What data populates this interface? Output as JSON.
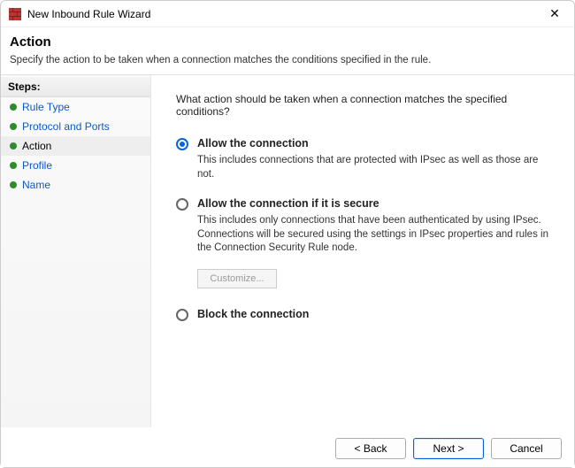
{
  "window": {
    "title": "New Inbound Rule Wizard"
  },
  "header": {
    "title": "Action",
    "subtitle": "Specify the action to be taken when a connection matches the conditions specified in the rule."
  },
  "steps": {
    "label": "Steps:",
    "items": [
      {
        "label": "Rule Type",
        "current": false
      },
      {
        "label": "Protocol and Ports",
        "current": false
      },
      {
        "label": "Action",
        "current": true
      },
      {
        "label": "Profile",
        "current": false
      },
      {
        "label": "Name",
        "current": false
      }
    ]
  },
  "main": {
    "prompt": "What action should be taken when a connection matches the specified conditions?",
    "options": [
      {
        "id": "allow",
        "label": "Allow the connection",
        "desc": "This includes connections that are protected with IPsec as well as those are not.",
        "checked": true
      },
      {
        "id": "allow-secure",
        "label": "Allow the connection if it is secure",
        "desc": "This includes only connections that have been authenticated by using IPsec.   Connections will be secured using the settings in IPsec properties and rules in the Connection Security Rule node.",
        "checked": false
      },
      {
        "id": "block",
        "label": "Block the connection",
        "desc": "",
        "checked": false
      }
    ],
    "customize_label": "Customize..."
  },
  "footer": {
    "back": "< Back",
    "next": "Next >",
    "cancel": "Cancel"
  }
}
